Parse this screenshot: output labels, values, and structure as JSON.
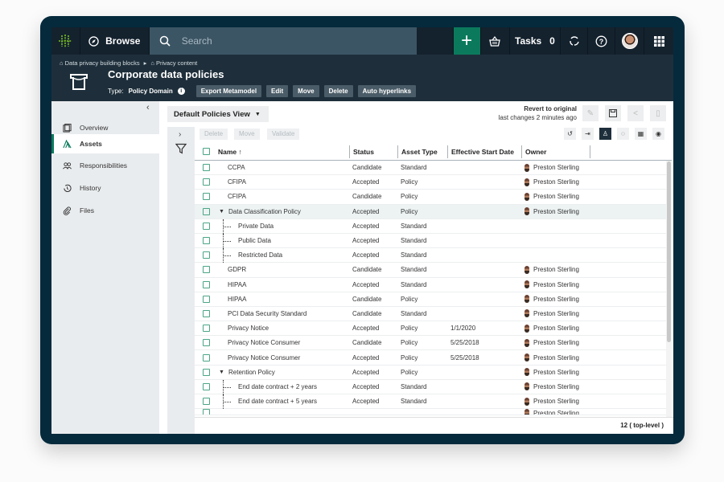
{
  "topnav": {
    "browse_label": "Browse",
    "search_placeholder": "Search",
    "tasks_label": "Tasks",
    "tasks_count": "0",
    "icons": [
      "logo-icon",
      "compass-icon",
      "search-icon",
      "plus-icon",
      "basket-icon",
      "refresh-icon",
      "help-icon",
      "user-avatar",
      "apps-grid-icon"
    ]
  },
  "colors": {
    "nav_bg": "#14222e",
    "header_bg": "#1e2f3b",
    "accent": "#0b7a5c",
    "search_bg": "#3c5564"
  },
  "header": {
    "breadcrumb": [
      "Data privacy building blocks",
      "Privacy content"
    ],
    "title": "Corporate data policies",
    "type_label": "Type:",
    "type_value": "Policy Domain",
    "buttons": [
      "Export Metamodel",
      "Edit",
      "Move",
      "Delete",
      "Auto hyperlinks"
    ]
  },
  "sidebar": {
    "items": [
      {
        "label": "Overview",
        "icon": "overview-icon"
      },
      {
        "label": "Assets",
        "icon": "assets-icon",
        "active": true
      },
      {
        "label": "Responsibilities",
        "icon": "people-icon"
      },
      {
        "label": "History",
        "icon": "history-icon"
      },
      {
        "label": "Files",
        "icon": "paperclip-icon"
      }
    ]
  },
  "main": {
    "view_name": "Default Policies View",
    "revert_label": "Revert to original",
    "last_changes": "last changes 2 minutes ago",
    "bulk_actions": [
      "Delete",
      "Move",
      "Validate"
    ],
    "columns": [
      "Name",
      "Status",
      "Asset Type",
      "Effective Start Date",
      "Owner"
    ],
    "rows": [
      {
        "name": "CCPA",
        "status": "Candidate",
        "type": "Standard",
        "date": "",
        "owner": "Preston Sterling",
        "level": 0
      },
      {
        "name": "CFIPA",
        "status": "Accepted",
        "type": "Policy",
        "date": "",
        "owner": "Preston Sterling",
        "level": 0
      },
      {
        "name": "CFIPA",
        "status": "Candidate",
        "type": "Policy",
        "date": "",
        "owner": "Preston Sterling",
        "level": 0
      },
      {
        "name": "Data Classification Policy",
        "status": "Accepted",
        "type": "Policy",
        "date": "",
        "owner": "Preston Sterling",
        "level": 0,
        "expanded": true
      },
      {
        "name": "Private Data",
        "status": "Accepted",
        "type": "Standard",
        "date": "",
        "owner": "",
        "level": 1
      },
      {
        "name": "Public Data",
        "status": "Accepted",
        "type": "Standard",
        "date": "",
        "owner": "",
        "level": 1
      },
      {
        "name": "Restricted Data",
        "status": "Accepted",
        "type": "Standard",
        "date": "",
        "owner": "",
        "level": 1
      },
      {
        "name": "GDPR",
        "status": "Candidate",
        "type": "Standard",
        "date": "",
        "owner": "Preston Sterling",
        "level": 0
      },
      {
        "name": "HIPAA",
        "status": "Accepted",
        "type": "Standard",
        "date": "",
        "owner": "Preston Sterling",
        "level": 0
      },
      {
        "name": "HIPAA",
        "status": "Candidate",
        "type": "Policy",
        "date": "",
        "owner": "Preston Sterling",
        "level": 0
      },
      {
        "name": "PCI Data Security Standard",
        "status": "Candidate",
        "type": "Standard",
        "date": "",
        "owner": "Preston Sterling",
        "level": 0
      },
      {
        "name": "Privacy Notice",
        "status": "Accepted",
        "type": "Policy",
        "date": "1/1/2020",
        "owner": "Preston Sterling",
        "level": 0
      },
      {
        "name": "Privacy Notice Consumer",
        "status": "Candidate",
        "type": "Policy",
        "date": "5/25/2018",
        "owner": "Preston Sterling",
        "level": 0
      },
      {
        "name": "Privacy Notice Consumer",
        "status": "Accepted",
        "type": "Policy",
        "date": "5/25/2018",
        "owner": "Preston Sterling",
        "level": 0
      },
      {
        "name": "Retention Policy",
        "status": "Accepted",
        "type": "Policy",
        "date": "",
        "owner": "Preston Sterling",
        "level": 0,
        "expanded": true
      },
      {
        "name": "End date contract + 2 years",
        "status": "Accepted",
        "type": "Standard",
        "date": "",
        "owner": "Preston Sterling",
        "level": 1
      },
      {
        "name": "End date contract + 5 years",
        "status": "Accepted",
        "type": "Standard",
        "date": "",
        "owner": "Preston Sterling",
        "level": 1
      }
    ],
    "partial_row_owner": "Preston Sterling",
    "count_label": "12 ( top-level )"
  }
}
